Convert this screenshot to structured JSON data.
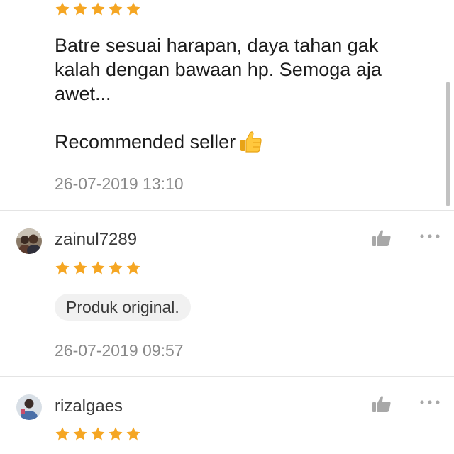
{
  "colors": {
    "star": "#f5a623",
    "like_icon": "#a8a8a8",
    "divider": "#e4e4e4"
  },
  "top_review": {
    "rating": 5,
    "text_lines": [
      "Batre sesuai harapan, daya tahan gak kalah dengan bawaan hp. Semoga aja awet..."
    ],
    "text_line_2": "Recommended seller",
    "emoji": "thumbs-up-emoji",
    "timestamp": "26-07-2019 13:10"
  },
  "reviews": [
    {
      "username": "zainul7289",
      "rating": 5,
      "tag": "Produk original.",
      "timestamp": "26-07-2019 09:57",
      "avatar_icon": "user-photo",
      "like_icon": "thumbs-up-icon",
      "more_icon": "more-dots-icon"
    },
    {
      "username": "rizalgaes",
      "rating": 5,
      "avatar_icon": "user-photo",
      "like_icon": "thumbs-up-icon",
      "more_icon": "more-dots-icon"
    }
  ]
}
